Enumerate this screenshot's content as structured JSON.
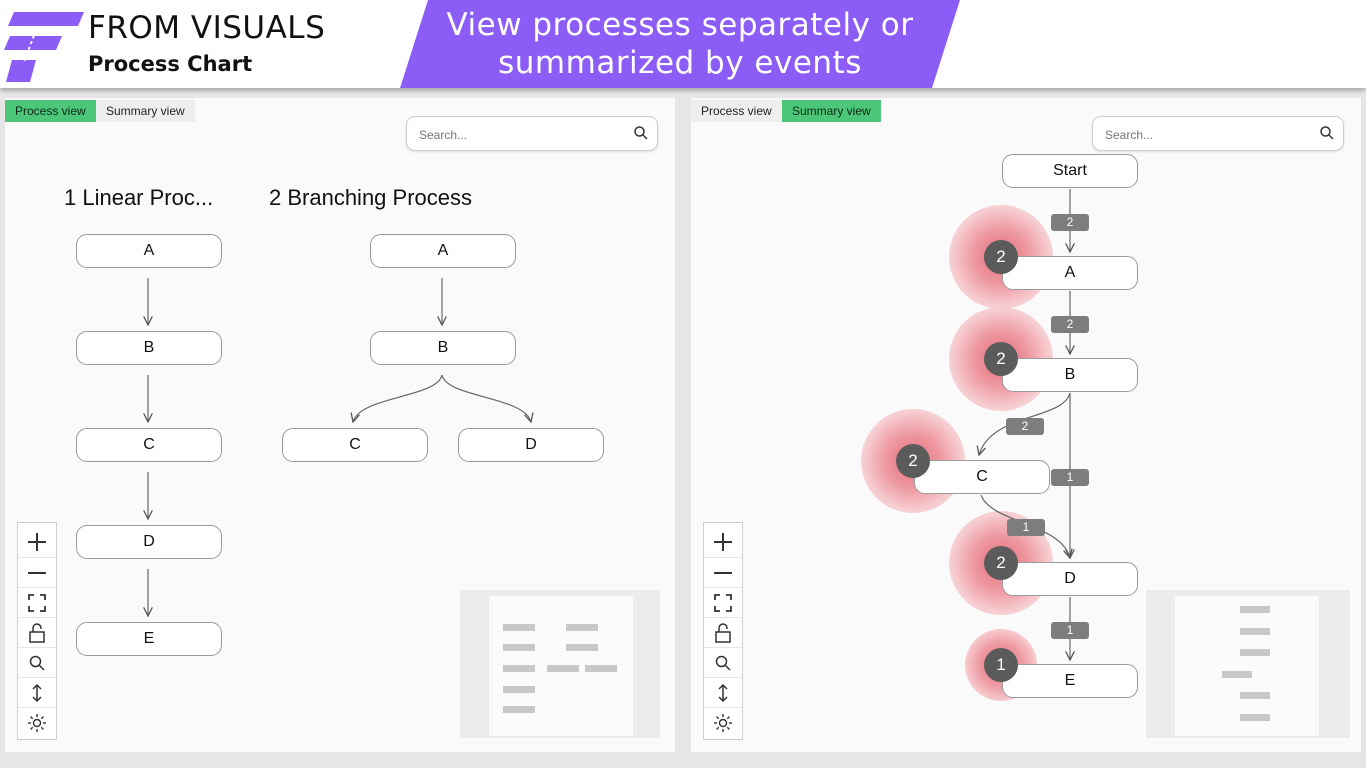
{
  "header": {
    "brand_title": "FROM VISUALS",
    "brand_subtitle": "Process Chart",
    "banner_line1": "View processes separately or",
    "banner_line2": "summarized by events",
    "brand_color": "#8b5cf6"
  },
  "left_panel": {
    "tabs": [
      {
        "label": "Process view",
        "active": true
      },
      {
        "label": "Summary view",
        "active": false
      }
    ],
    "search_placeholder": "Search...",
    "processes": [
      {
        "title": "1 Linear Proc...",
        "nodes": [
          "A",
          "B",
          "C",
          "D",
          "E"
        ]
      },
      {
        "title": "2 Branching Process",
        "nodes": [
          "A",
          "B",
          "C",
          "D"
        ]
      }
    ]
  },
  "right_panel": {
    "tabs": [
      {
        "label": "Process view",
        "active": false
      },
      {
        "label": "Summary view",
        "active": true
      }
    ],
    "search_placeholder": "Search...",
    "nodes": [
      {
        "label": "Start"
      },
      {
        "label": "A",
        "count": "2"
      },
      {
        "label": "B",
        "count": "2"
      },
      {
        "label": "C",
        "count": "2"
      },
      {
        "label": "D",
        "count": "2"
      },
      {
        "label": "E",
        "count": "1"
      }
    ],
    "edges": [
      {
        "from": "Start",
        "to": "A",
        "count": "2"
      },
      {
        "from": "A",
        "to": "B",
        "count": "2"
      },
      {
        "from": "B",
        "to": "C",
        "count": "2"
      },
      {
        "from": "B",
        "to": "D",
        "count": "1"
      },
      {
        "from": "C",
        "to": "D",
        "count": "1"
      },
      {
        "from": "D",
        "to": "E",
        "count": "1"
      }
    ]
  },
  "toolbar_icons": [
    "zoom-in-icon",
    "zoom-out-icon",
    "fit-view-icon",
    "lock-icon",
    "search-icon",
    "vertical-layout-icon",
    "settings-icon"
  ],
  "colors": {
    "active_tab": "#4cc77a",
    "halo": "#e98a92",
    "badge": "#5b5b5b",
    "edge_label": "#7d7d7d"
  }
}
